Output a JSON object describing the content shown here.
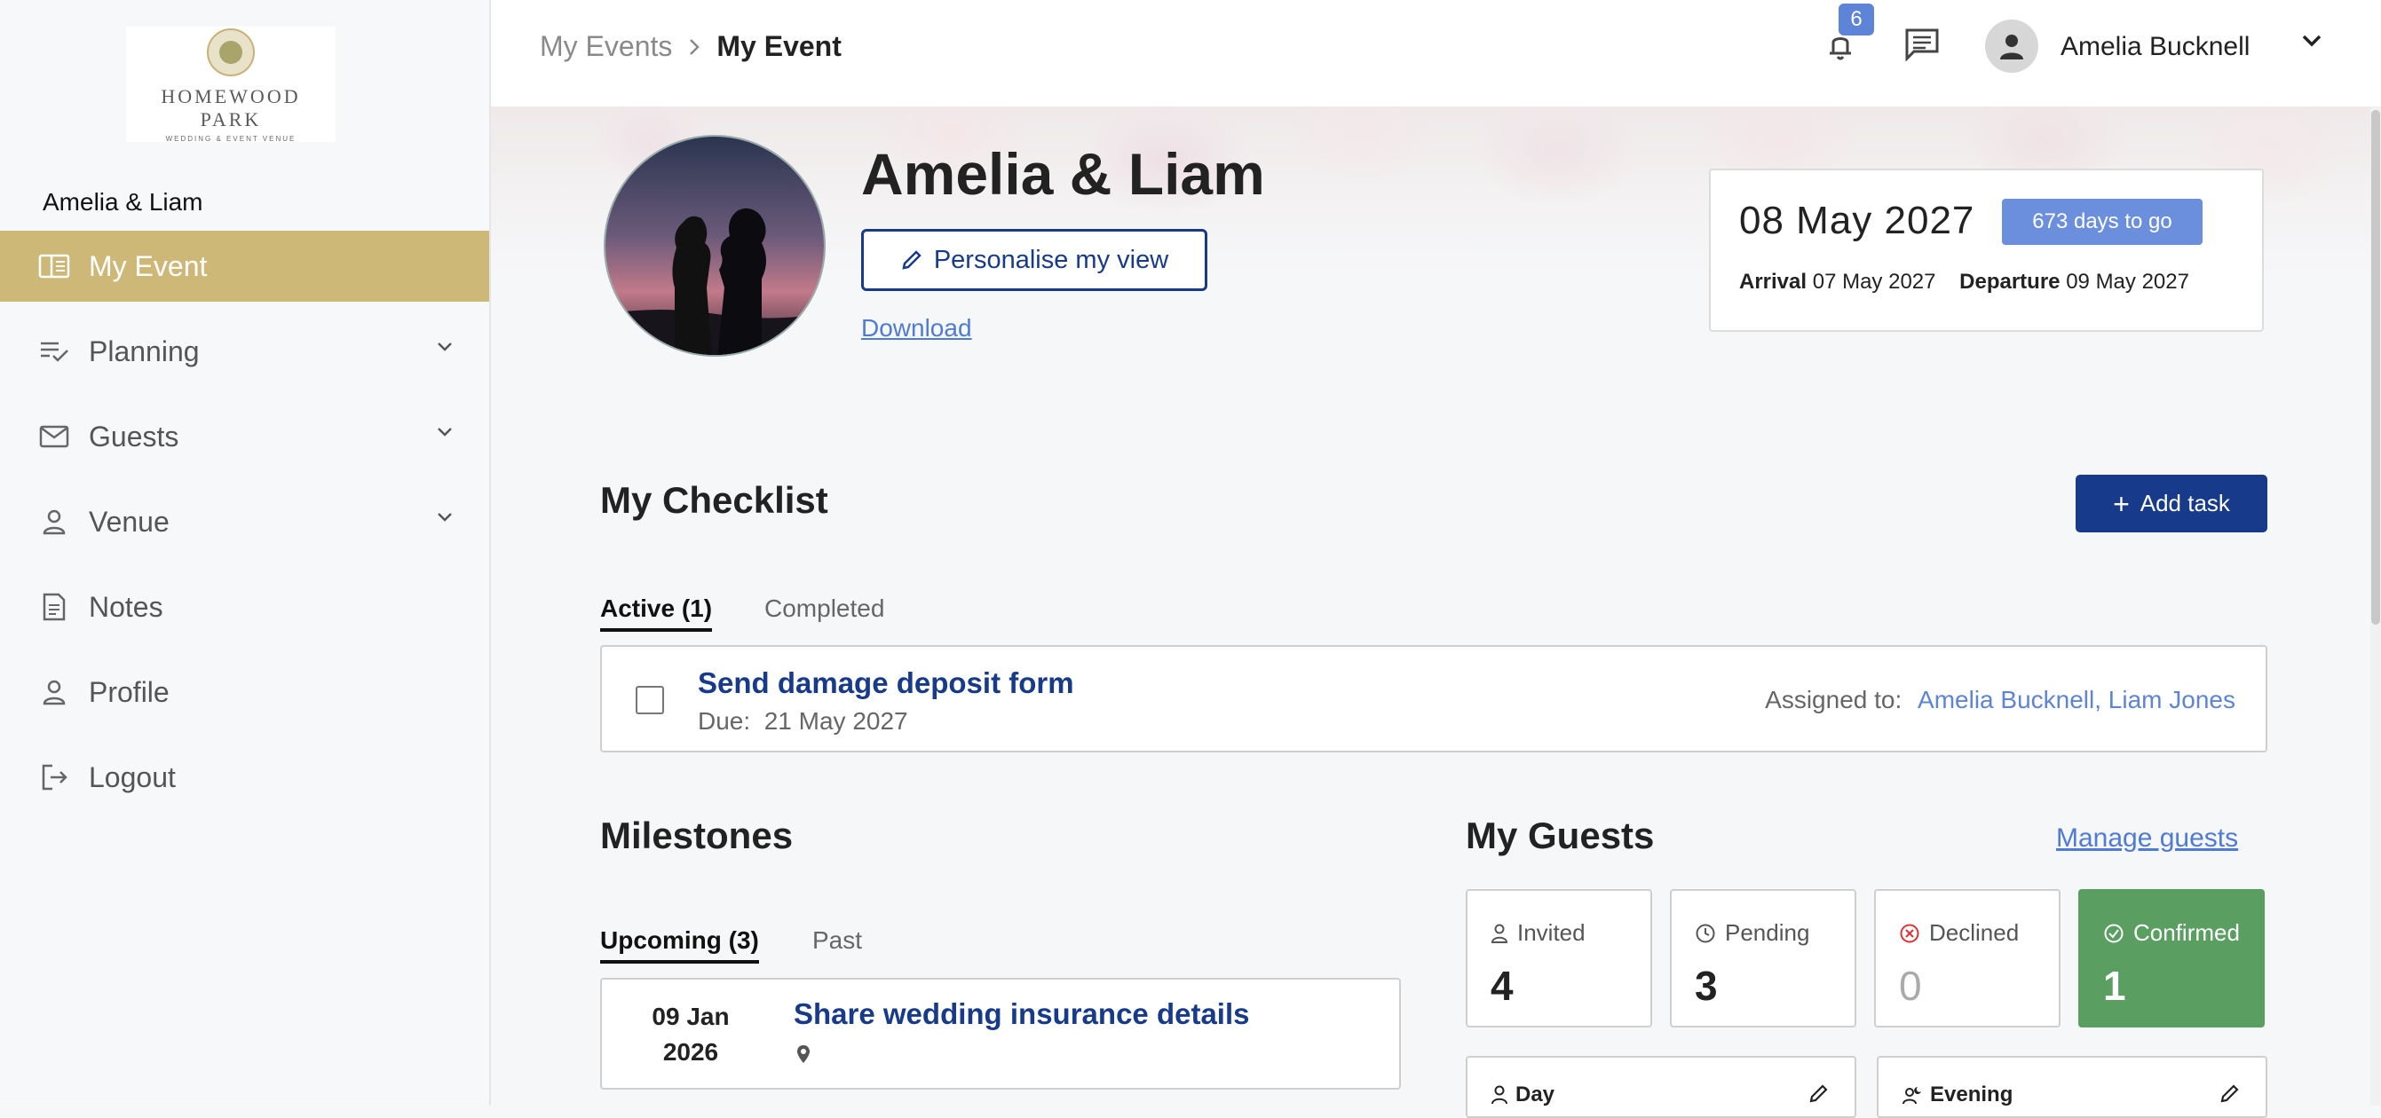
{
  "sidebar": {
    "logo": {
      "name_line1": "HOMEWOOD",
      "name_line2": "PARK",
      "tagline": "WEDDING & EVENT VENUE"
    },
    "event_name": "Amelia & Liam",
    "items": [
      {
        "label": "My Event",
        "icon": "book-open-icon",
        "active": true
      },
      {
        "label": "Planning",
        "icon": "checklist-icon",
        "expandable": true
      },
      {
        "label": "Guests",
        "icon": "envelope-icon",
        "expandable": true
      },
      {
        "label": "Venue",
        "icon": "person-icon",
        "expandable": true
      },
      {
        "label": "Notes",
        "icon": "document-icon"
      },
      {
        "label": "Profile",
        "icon": "person-icon"
      },
      {
        "label": "Logout",
        "icon": "logout-icon"
      }
    ],
    "active_color": "#cdb878"
  },
  "topbar": {
    "breadcrumb": {
      "parent": "My Events",
      "current": "My Event"
    },
    "notifications_count": "6",
    "user_name": "Amelia Bucknell"
  },
  "hero": {
    "title": "Amelia & Liam",
    "personalise_label": "Personalise my view",
    "download_label": "Download",
    "date_card": {
      "date": "08 May 2027",
      "countdown": "673 days to go",
      "arrival_label": "Arrival",
      "arrival_date": "07 May 2027",
      "departure_label": "Departure",
      "departure_date": "09 May 2027"
    }
  },
  "checklist": {
    "title": "My Checklist",
    "add_label": "Add task",
    "tabs": [
      "Active (1)",
      "Completed"
    ],
    "tasks": [
      {
        "title": "Send damage deposit form",
        "due_label": "Due:",
        "due_date": "21 May 2027",
        "assigned_label": "Assigned to:",
        "assignees": "Amelia Bucknell, Liam Jones"
      }
    ]
  },
  "milestones": {
    "title": "Milestones",
    "tabs": [
      "Upcoming (3)",
      "Past"
    ],
    "items": [
      {
        "date_line1": "09 Jan",
        "date_line2": "2026",
        "title": "Share wedding insurance details"
      }
    ]
  },
  "guests": {
    "title": "My Guests",
    "manage_label": "Manage guests",
    "stats": [
      {
        "label": "Invited",
        "value": "4"
      },
      {
        "label": "Pending",
        "value": "3"
      },
      {
        "label": "Declined",
        "value": "0"
      },
      {
        "label": "Confirmed",
        "value": "1"
      }
    ],
    "sub_cards": [
      {
        "label": "Day"
      },
      {
        "label": "Evening"
      }
    ],
    "confirmed_color": "#5a9e61",
    "declined_color": "#d33"
  },
  "colors": {
    "primary": "#173a8a",
    "link": "#4f7bd4",
    "badge": "#6b8fdc"
  }
}
